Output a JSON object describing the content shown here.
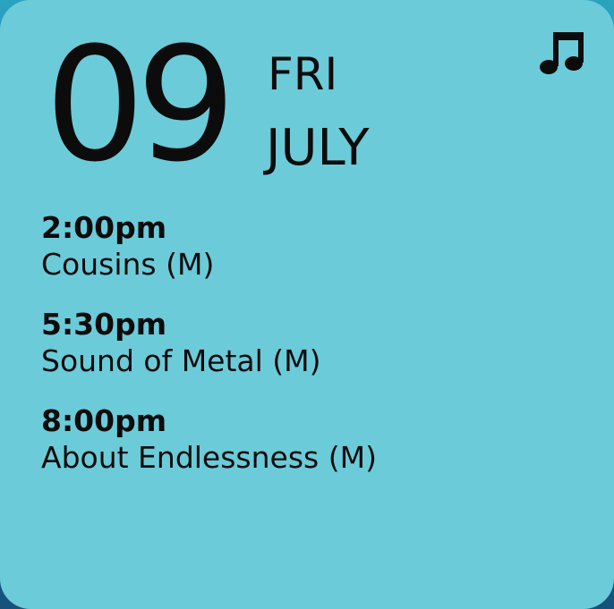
{
  "widget": {
    "day_number": "09",
    "weekday": "FRI",
    "month": "JULY",
    "icon": "music-note-icon",
    "colors": {
      "card_background": "#6ccbd9",
      "text": "#0c0c0c",
      "backdrop": "#1e78a3"
    }
  },
  "events": [
    {
      "time": "2:00pm",
      "title": "Cousins (M)"
    },
    {
      "time": "5:30pm",
      "title": "Sound of Metal (M)"
    },
    {
      "time": "8:00pm",
      "title": "About Endlessness (M)"
    }
  ]
}
